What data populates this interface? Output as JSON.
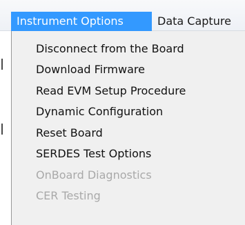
{
  "menubar": {
    "items": [
      {
        "label": "Instrument Options",
        "active": true
      },
      {
        "label": "Data Capture"
      }
    ]
  },
  "dropdown": {
    "items": [
      {
        "label": "Disconnect from the Board",
        "enabled": true
      },
      {
        "label": "Download Firmware",
        "enabled": true
      },
      {
        "label": "Read EVM Setup Procedure",
        "enabled": true
      },
      {
        "label": "Dynamic Configuration",
        "enabled": true
      },
      {
        "label": "Reset Board",
        "enabled": true
      },
      {
        "label": "SERDES Test Options",
        "enabled": true
      },
      {
        "label": "OnBoard Diagnostics",
        "enabled": false
      },
      {
        "label": "CER Testing",
        "enabled": false
      }
    ]
  },
  "colors": {
    "highlight": "#3399ff",
    "menu_background": "#f0f0f0",
    "disabled_text": "#a9a9a9"
  }
}
